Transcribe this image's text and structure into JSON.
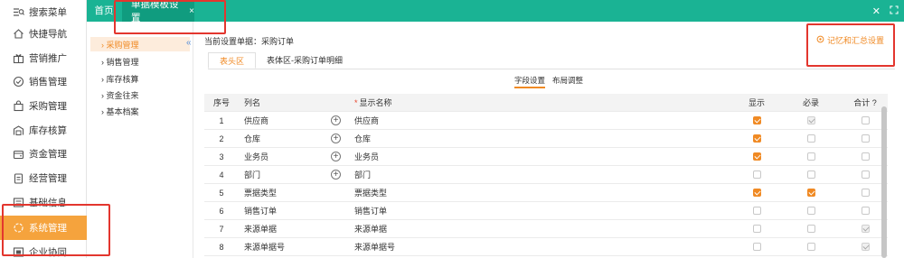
{
  "nav": {
    "items": [
      {
        "label": "搜索菜单",
        "icon": "search-menu-icon"
      },
      {
        "label": "快捷导航",
        "icon": "home-icon"
      },
      {
        "label": "营销推广",
        "icon": "gift-icon"
      },
      {
        "label": "销售管理",
        "icon": "badge-icon"
      },
      {
        "label": "采购管理",
        "icon": "shop-icon"
      },
      {
        "label": "库存核算",
        "icon": "warehouse-icon"
      },
      {
        "label": "资金管理",
        "icon": "wallet-icon"
      },
      {
        "label": "经营管理",
        "icon": "clipboard-icon"
      },
      {
        "label": "基础信息",
        "icon": "list-icon"
      },
      {
        "label": "系统管理",
        "icon": "settings-icon"
      },
      {
        "label": "企业协同",
        "icon": "share-icon"
      }
    ]
  },
  "topbar": {
    "home_tab": "首页",
    "active_tab": "单据模板设置",
    "close_glyph": "×"
  },
  "submenu": {
    "items": [
      "采购管理",
      "销售管理",
      "库存核算",
      "资金往来",
      "基本档案"
    ],
    "collapse_glyph": "«"
  },
  "main": {
    "current_doc": "当前设置单据：采购订单",
    "memo_link": "记忆和汇总设置",
    "tabs": [
      "表头区",
      "表体区-采购订单明细"
    ],
    "subtabs": [
      "字段设置",
      "布局调整"
    ],
    "columns": {
      "no": "序号",
      "col": "列名",
      "display": "显示名称",
      "show": "显示",
      "must": "必录",
      "sum": "合计"
    },
    "rows": [
      {
        "no": "1",
        "col": "供应商",
        "display": "供应商",
        "plus": true,
        "show": "on",
        "must": "dis-chk",
        "sum": "off"
      },
      {
        "no": "2",
        "col": "仓库",
        "display": "仓库",
        "plus": true,
        "show": "on",
        "must": "off",
        "sum": "off"
      },
      {
        "no": "3",
        "col": "业务员",
        "display": "业务员",
        "plus": true,
        "show": "on",
        "must": "off",
        "sum": "off"
      },
      {
        "no": "4",
        "col": "部门",
        "display": "部门",
        "plus": true,
        "show": "off",
        "must": "off",
        "sum": "off"
      },
      {
        "no": "5",
        "col": "票据类型",
        "display": "票据类型",
        "plus": false,
        "show": "on",
        "must": "on",
        "sum": "off"
      },
      {
        "no": "6",
        "col": "销售订单",
        "display": "销售订单",
        "plus": false,
        "show": "off",
        "must": "off",
        "sum": "off"
      },
      {
        "no": "7",
        "col": "来源单据",
        "display": "来源单据",
        "plus": false,
        "show": "off",
        "must": "off",
        "sum": "dis-chk"
      },
      {
        "no": "8",
        "col": "来源单据号",
        "display": "来源单据号",
        "plus": false,
        "show": "off",
        "must": "off",
        "sum": "dis-chk"
      }
    ]
  },
  "colors": {
    "topbar": "#1ab394",
    "active_tab": "#109c7f",
    "accent_orange": "#f08a24",
    "nav_active": "#f5a33d",
    "annotation_red": "#e3362e"
  }
}
